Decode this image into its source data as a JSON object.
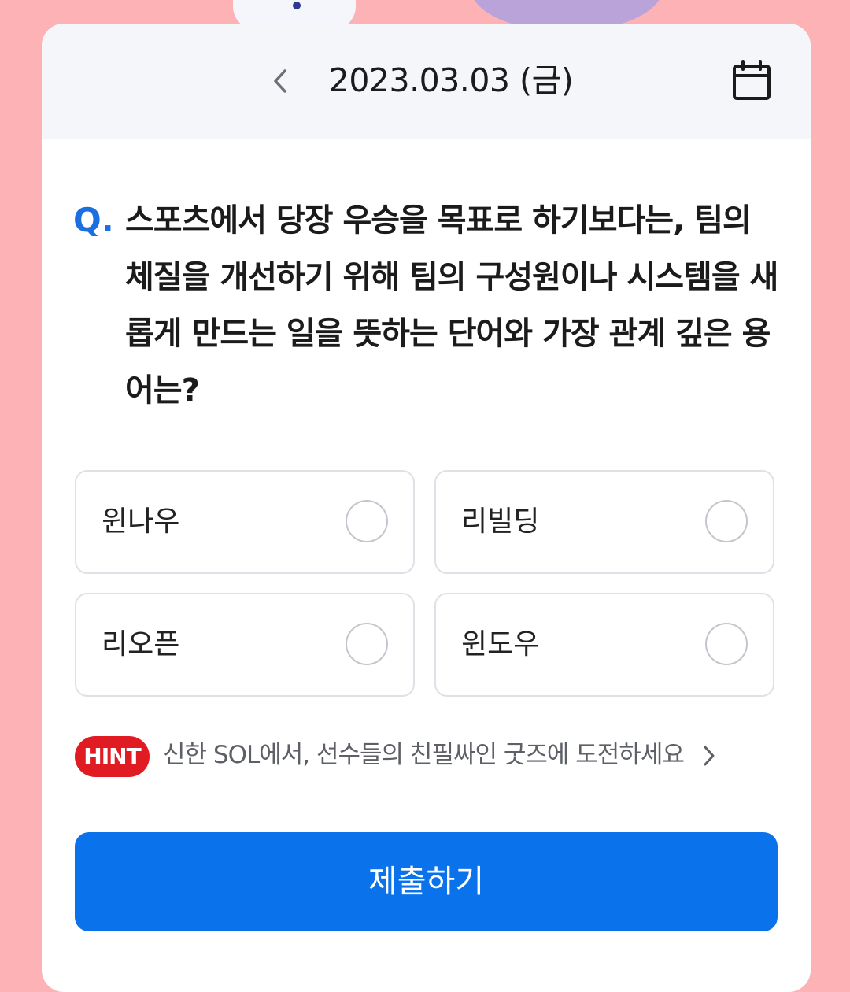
{
  "header": {
    "date": "2023.03.03 (금)",
    "prev_icon": "chevron-left-icon",
    "calendar_icon": "calendar-icon"
  },
  "question": {
    "prefix": "Q.",
    "text": "스포츠에서 당장 우승을 목표로 하기보다는, 팀의 체질을 개선하기 위해 팀의 구성원이나 시스템을 새롭게 만드는 일을 뜻하는 단어와 가장 관계 깊은 용어는?"
  },
  "options": [
    {
      "label": "윈나우",
      "selected": false
    },
    {
      "label": "리빌딩",
      "selected": false
    },
    {
      "label": "리오픈",
      "selected": false
    },
    {
      "label": "윈도우",
      "selected": false
    }
  ],
  "hint": {
    "badge": "HINT",
    "text": "신한 SOL에서, 선수들의 친필싸인 굿즈에 도전하세요",
    "chevron_icon": "chevron-right-icon"
  },
  "submit": {
    "label": "제출하기"
  },
  "colors": {
    "background": "#fdb3b5",
    "accent": "#0a72ea",
    "question_mark": "#1c6fe0",
    "hint_badge": "#e01b22"
  }
}
